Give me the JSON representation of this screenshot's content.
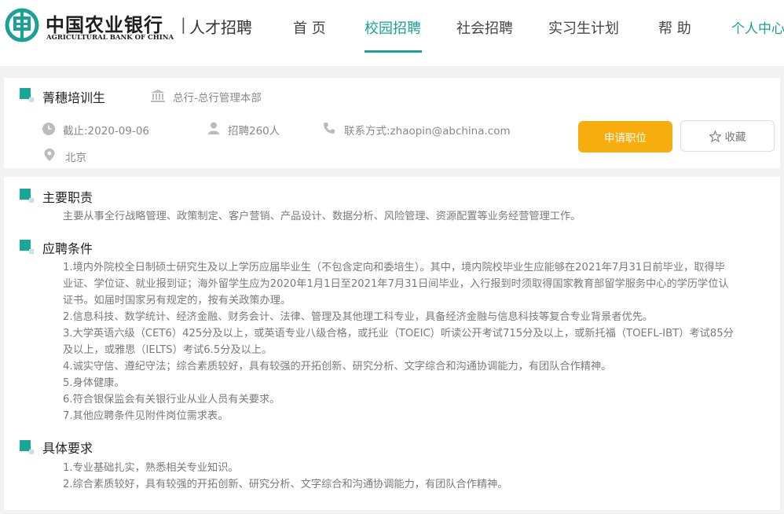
{
  "header": {
    "brand_cn": "中国农业银行",
    "brand_en": "AGRICULTURAL BANK OF CHINA",
    "separator": "|",
    "subtitle": "人才招聘",
    "nav": [
      "首 页",
      "校园招聘",
      "社会招聘",
      "实习生计划",
      "帮 助"
    ],
    "active_nav": "校园招聘",
    "user_center": "个人中心",
    "brand_color": "#1aa297"
  },
  "job": {
    "title": "菁穗培训生",
    "department": "总行-总行管理本部",
    "deadline": "截止:2020-09-06",
    "headcount": "招聘260人",
    "contact": "联系方式:zhaopin@abchina.com",
    "location": "北京",
    "apply_label": "申请职位",
    "favorite_label": "收藏",
    "accent_color": "#f8ad0e"
  },
  "sections": {
    "duties": {
      "title": "主要职责",
      "lines": [
        "主要从事全行战略管理、政策制定、客户营销、产品设计、数据分析、风险管理、资源配置等业务经营管理工作。"
      ]
    },
    "requirements": {
      "title": "应聘条件",
      "lines": [
        "1.境内外院校全日制硕士研究生及以上学历应届毕业生（不包含定向和委培生）。其中，境内院校毕业生应能够在2021年7月31日前毕业，取得毕",
        "业证、学位证、就业报到证；海外留学生应为2020年1月1日至2021年7月31日间毕业，入行报到时须取得国家教育部留学服务中心的学历学位认",
        "证书。如届时国家另有规定的，按有关政策办理。",
        "2.信息科技、数学统计、经济金融、财务会计、法律、管理及其他理工科专业，具备经济金融与信息科技等复合专业背景者优先。",
        "3.大学英语六级（CET6）425分及以上，或英语专业八级合格，或托业（TOEIC）听读公开考试715分及以上，或新托福（TOEFL-IBT）考试85分",
        "及以上，或雅思（IELTS）考试6.5分及以上。",
        "4.诚实守信、遵纪守法；综合素质较好，具有较强的开拓创新、研究分析、文字综合和沟通协调能力，有团队合作精神。",
        "5.身体健康。",
        "6.符合银保监会有关银行业从业人员有关要求。",
        "7.其他应聘条件见附件岗位需求表。"
      ]
    },
    "specifics": {
      "title": "具体要求",
      "lines": [
        "1.专业基础扎实，熟悉相关专业知识。",
        "2.综合素质较好，具有较强的开拓创新、研究分析、文字综合和沟通协调能力，有团队合作精神。"
      ]
    }
  },
  "icons": {
    "logo": "abc-logo-icon",
    "department": "bank-building-icon",
    "deadline": "clock-icon",
    "headcount": "person-icon",
    "contact": "phone-icon",
    "location": "location-pin-icon",
    "favorite": "star-outline-icon"
  }
}
